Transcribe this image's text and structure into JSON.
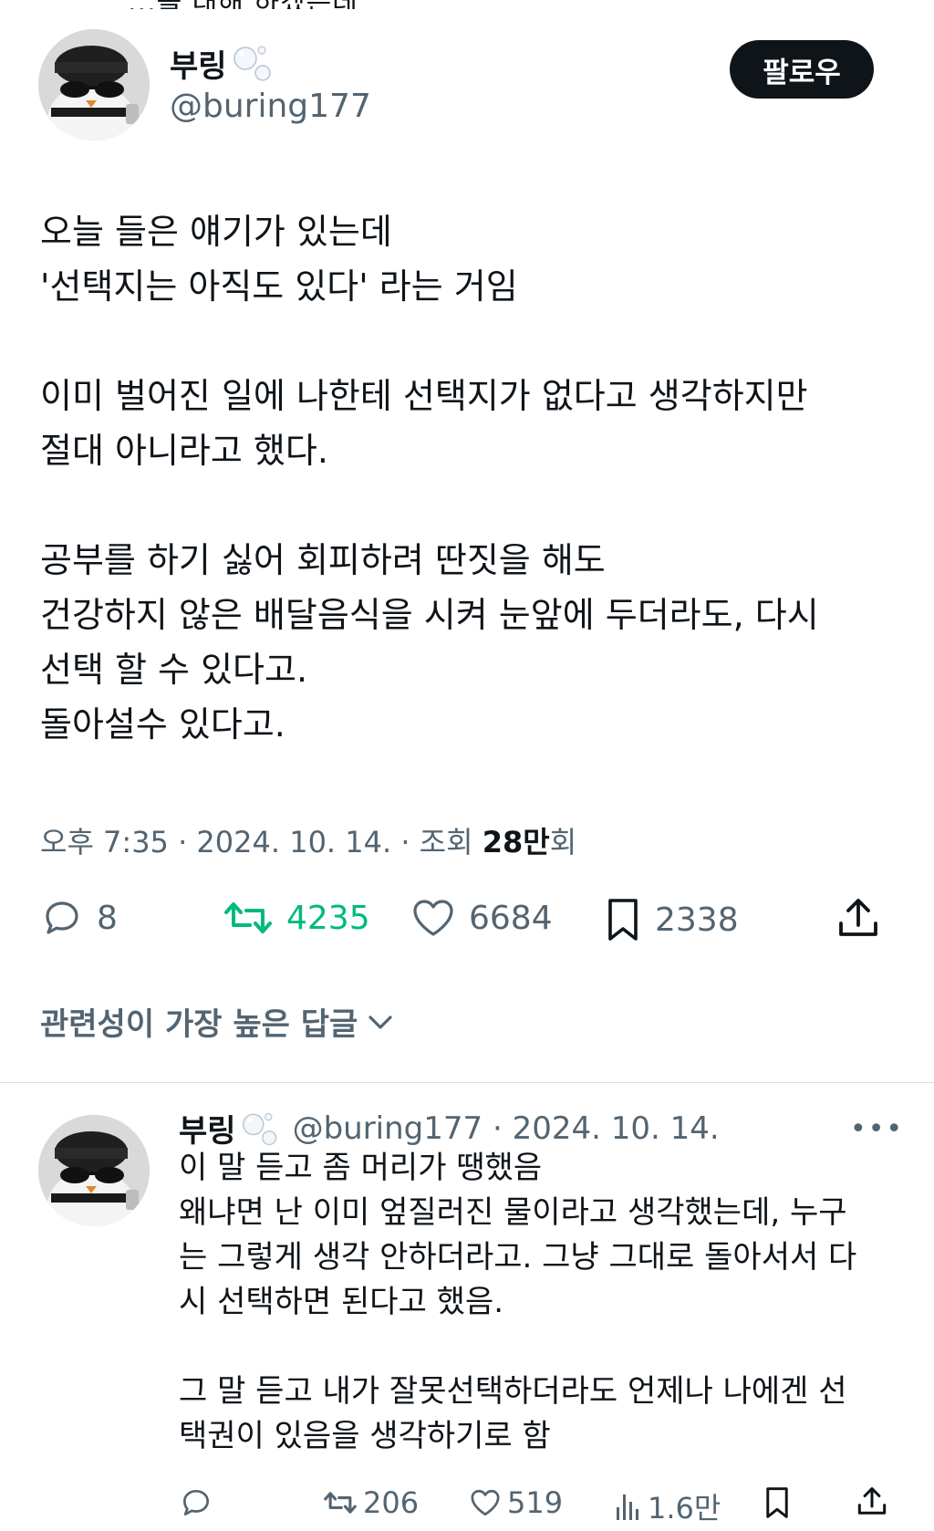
{
  "top_cut_text": "...을 대해 하겠는데",
  "tweet": {
    "display_name": "부링",
    "handle": "@buring177",
    "follow_label": "팔로우",
    "paragraphs": [
      "오늘 들은 얘기가 있는데\n'선택지는 아직도 있다' 라는 거임",
      "이미 벌어진 일에 나한테 선택지가 없다고 생각하지만\n절대 아니라고 했다.",
      "공부를 하기 싫어 회피하려 딴짓을 해도\n건강하지 않은 배달음식을 시켜 눈앞에 두더라도, 다시\n선택 할 수 있다고.\n돌아설수 있다고."
    ],
    "time": "오후 7:35 · 2024. 10. 14. · 조회 ",
    "views_count": "28만",
    "views_suffix": "회",
    "stats": {
      "replies": "8",
      "retweets": "4235",
      "likes": "6684",
      "bookmarks": "2338"
    }
  },
  "sort_label": "관련성이 가장 높은 답글",
  "reply": {
    "display_name": "부링",
    "handle_date": "@buring177 · 2024. 10. 14.",
    "lines": [
      "이 말 듣고 좀 머리가 땡했음",
      "왜냐면 난 이미 엎질러진 물이라고 생각했는데, 누구",
      "는 그렇게 생각 안하더라고. 그냥 그대로 돌아서서 다",
      "시 선택하면 된다고 했음."
    ],
    "lines2": [
      "그 말 듣고 내가 잘못선택하더라도 언제나 나에겐 선",
      "택권이 있음을 생각하기로 함"
    ],
    "stats": {
      "retweets": "206",
      "likes": "519",
      "views": "1.6만"
    }
  },
  "colors": {
    "text": "#0f1419",
    "secondary": "#536471",
    "retweet_active": "#00ba7c",
    "button_bg": "#0f1419"
  }
}
